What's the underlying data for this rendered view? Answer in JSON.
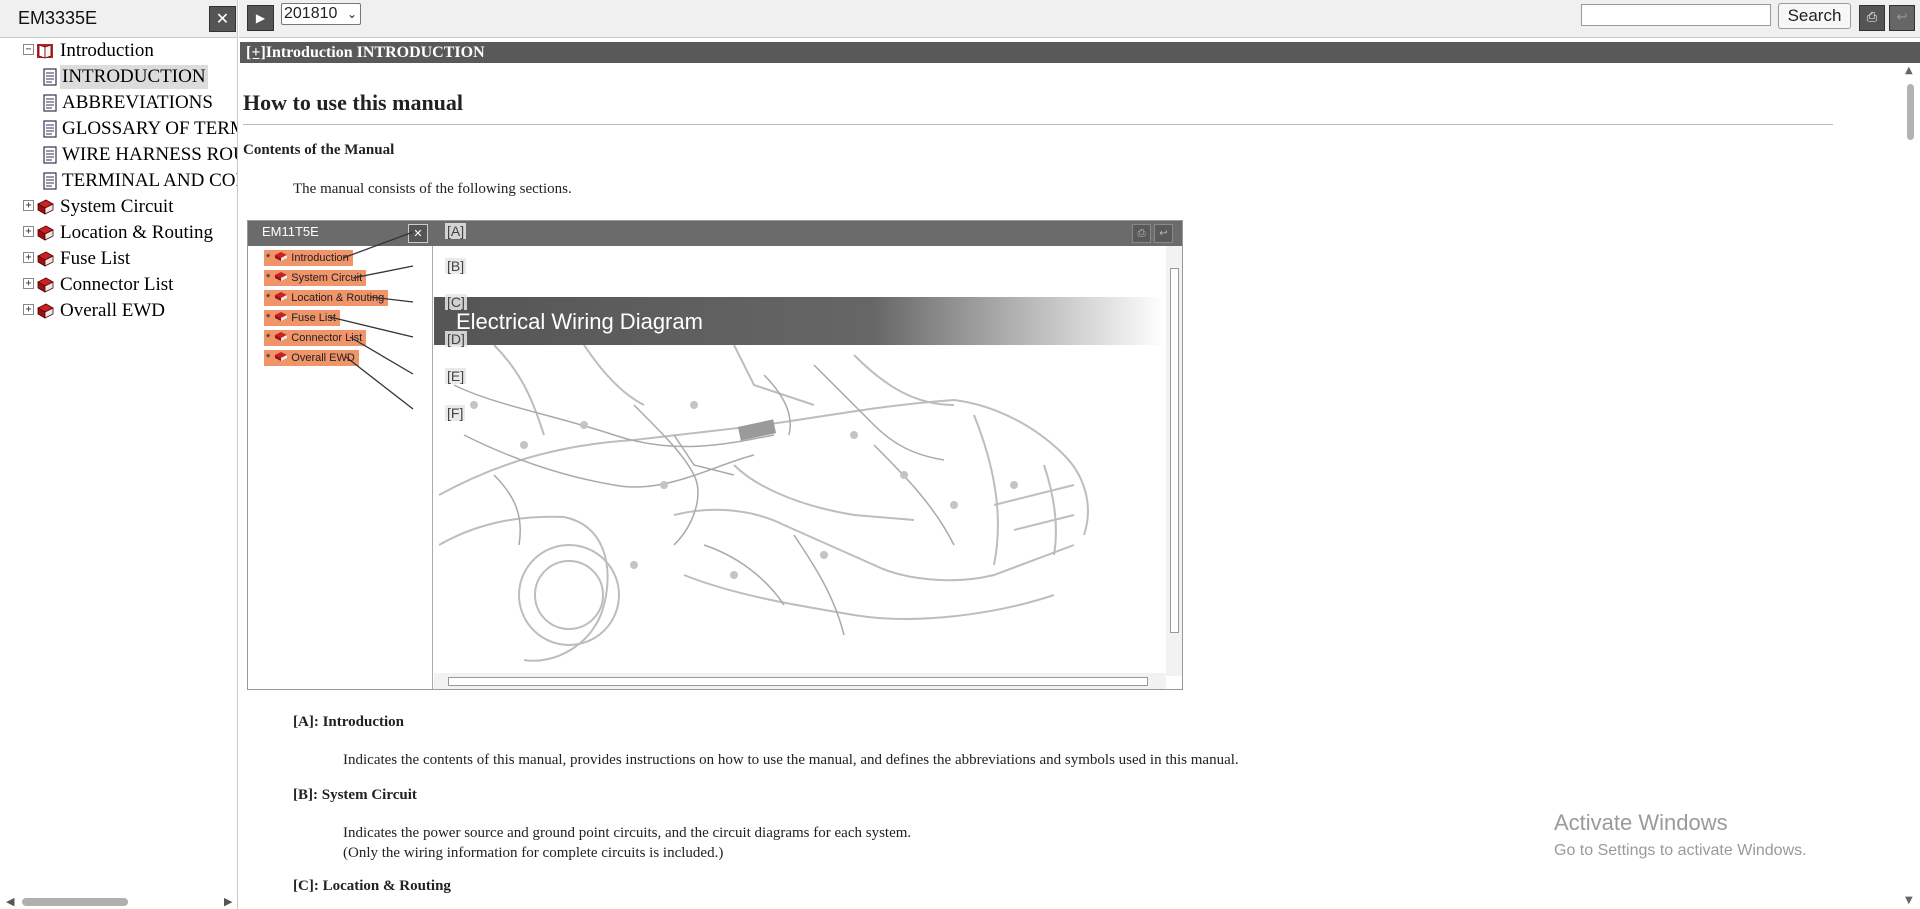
{
  "left_panel": {
    "doc_title": "EM3335E",
    "close_label": "✕",
    "tree": [
      {
        "label": "Introduction",
        "expander": "−",
        "icon": "open-book-icon",
        "selected": false
      },
      {
        "label": "INTRODUCTION",
        "icon": "page-icon",
        "selected": true
      },
      {
        "label": "ABBREVIATIONS",
        "icon": "page-icon",
        "selected": false
      },
      {
        "label": "GLOSSARY OF TERMS AND SYMBOLS",
        "icon": "page-icon",
        "selected": false
      },
      {
        "label": "WIRE HARNESS ROUTING",
        "icon": "page-icon",
        "selected": false
      },
      {
        "label": "TERMINAL AND CONNECTOR REPAIR",
        "icon": "page-icon",
        "selected": false
      },
      {
        "label": "System Circuit",
        "expander": "+",
        "icon": "red-book-icon",
        "selected": false
      },
      {
        "label": "Location & Routing",
        "expander": "+",
        "icon": "red-book-icon",
        "selected": false
      },
      {
        "label": "Fuse List",
        "expander": "+",
        "icon": "red-book-icon",
        "selected": false
      },
      {
        "label": "Connector List",
        "expander": "+",
        "icon": "red-book-icon",
        "selected": false
      },
      {
        "label": "Overall EWD",
        "expander": "+",
        "icon": "red-book-icon",
        "selected": false
      }
    ]
  },
  "toolbar": {
    "version": "201810",
    "search_value": "",
    "search_label": "Search",
    "icons": [
      "print-icon",
      "back-icon"
    ]
  },
  "content": {
    "breadcrumb_prefix": "[+]",
    "breadcrumb": "Introduction  INTRODUCTION",
    "heading": "How to use this manual",
    "subheading": "Contents of the Manual",
    "intro": "The manual consists of the following sections.",
    "figure": {
      "title": "EM11T5E",
      "close_label": "✕",
      "items": [
        "Introduction",
        "System Circuit",
        "Location & Routing",
        "Fuse List",
        "Connector List",
        "Overall EWD"
      ],
      "callouts": [
        "[A]",
        "[B]",
        "[C]",
        "[D]",
        "[E]",
        "[F]"
      ],
      "banner": "Electrical Wiring Diagram"
    },
    "sections": [
      {
        "title": "[A]: Introduction",
        "lines": [
          "Indicates the contents of this manual, provides instructions on how to use the manual, and defines the abbreviations and symbols used in this manual."
        ]
      },
      {
        "title": "[B]: System Circuit",
        "lines": [
          "Indicates the power source and ground point circuits, and the circuit diagrams for each system.",
          "(Only the wiring information for complete circuits is included.)"
        ]
      },
      {
        "title": "[C]: Location & Routing",
        "lines": []
      }
    ]
  },
  "watermark": {
    "line1": "Activate Windows",
    "line2": "Go to Settings to activate Windows."
  },
  "colors": {
    "strip": "#595959",
    "highlight": "#f0946a",
    "button_dark": "#555555"
  }
}
